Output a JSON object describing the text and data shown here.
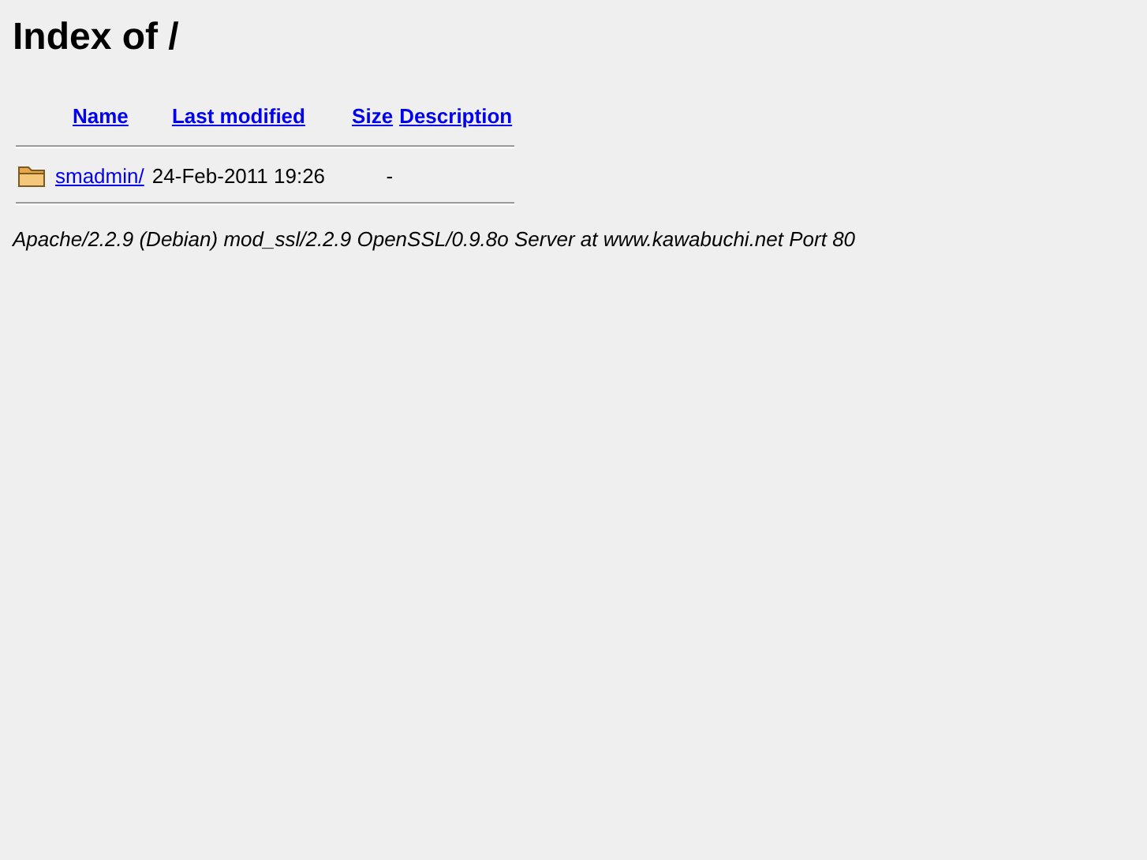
{
  "title": "Index of /",
  "columns": [
    {
      "label": "Name"
    },
    {
      "label": "Last modified"
    },
    {
      "label": "Size"
    },
    {
      "label": "Description"
    }
  ],
  "rows": [
    {
      "kind": "folder",
      "name": "smadmin/",
      "modified": "24-Feb-2011 19:26",
      "size": "-"
    }
  ],
  "address": "Apache/2.2.9 (Debian) mod_ssl/2.2.9 OpenSSL/0.9.8o Server at www.kawabuchi.net Port 80"
}
